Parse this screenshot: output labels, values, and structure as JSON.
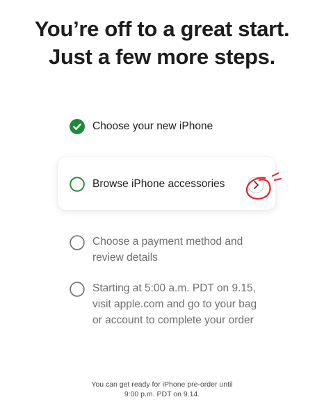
{
  "headline": {
    "line1": "You’re off to a great start.",
    "line2": "Just a few more steps."
  },
  "steps": [
    {
      "label": "Choose your new iPhone",
      "status": "complete",
      "icon": "check-circle-icon"
    },
    {
      "label": "Browse iPhone accessories",
      "status": "current",
      "icon": "circle-outline-icon",
      "action_icon": "chevron-right-icon"
    },
    {
      "label_lines": [
        "Choose a payment method and",
        "review details"
      ],
      "status": "pending",
      "icon": "circle-outline-icon"
    },
    {
      "label_lines": [
        "Starting at 5:00 a.m. PDT on 9.15,",
        "visit apple.com and go to your bag",
        "or account to complete your order"
      ],
      "status": "pending",
      "icon": "circle-outline-icon"
    }
  ],
  "footer": {
    "line1": "You can get ready for iPhone pre-order until",
    "line2": "9:00 p.m. PDT on 9.14."
  },
  "colors": {
    "complete": "#1d8a3a",
    "current_ring": "#2a8a3e",
    "pending_ring": "#6e6e73",
    "annotation": "#e3212b"
  }
}
